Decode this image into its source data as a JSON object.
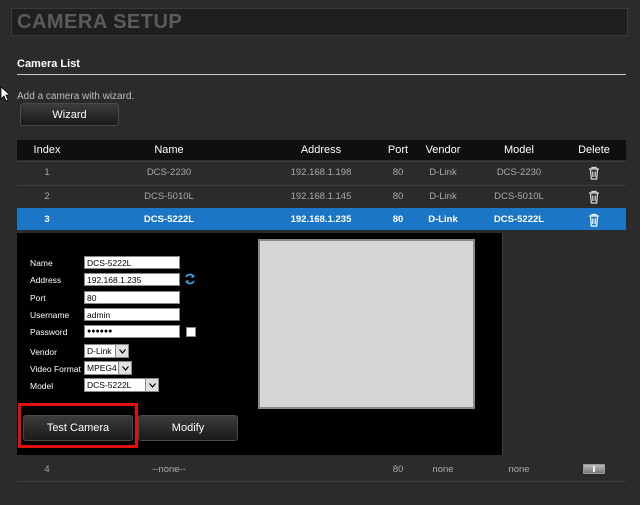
{
  "header": {
    "title": "CAMERA SETUP"
  },
  "camera_list": {
    "heading": "Camera List",
    "hint": "Add a camera with wizard.",
    "wizard_label": "Wizard",
    "columns": [
      "Index",
      "Name",
      "Address",
      "Port",
      "Vendor",
      "Model",
      "Delete"
    ],
    "rows": [
      {
        "index": "1",
        "name": "DCS-2230",
        "address": "192.168.1.198",
        "port": "80",
        "vendor": "D-Link",
        "model": "DCS-2230",
        "selected": false
      },
      {
        "index": "2",
        "name": "DCS-5010L",
        "address": "192.168.1.145",
        "port": "80",
        "vendor": "D-Link",
        "model": "DCS-5010L",
        "selected": false
      },
      {
        "index": "3",
        "name": "DCS-5222L",
        "address": "192.168.1.235",
        "port": "80",
        "vendor": "D-Link",
        "model": "DCS-5222L",
        "selected": true
      }
    ],
    "row4": {
      "index": "4",
      "name": "--none--",
      "address": "",
      "port": "80",
      "vendor": "none",
      "model": "none"
    }
  },
  "edit_form": {
    "name_label": "Name",
    "name_value": "DCS-5222L",
    "address_label": "Address",
    "address_value": "192.168.1.235",
    "port_label": "Port",
    "port_value": "80",
    "username_label": "Username",
    "username_value": "admin",
    "password_label": "Password",
    "password_value": "●●●●●●",
    "vendor_label": "Vendor",
    "vendor_value": "D-Link",
    "video_format_label": "Video Format",
    "video_format_value": "MPEG4",
    "model_label": "Model",
    "model_value": "DCS-5222L",
    "test_label": "Test Camera",
    "modify_label": "Modify"
  },
  "colors": {
    "selected_row": "#1b77c5",
    "highlight": "#e01010",
    "preview": "#d6d6d6"
  },
  "icons": {
    "delete": "trash-icon",
    "refresh": "refresh-icon",
    "dropdown": "chevron-down-icon"
  }
}
